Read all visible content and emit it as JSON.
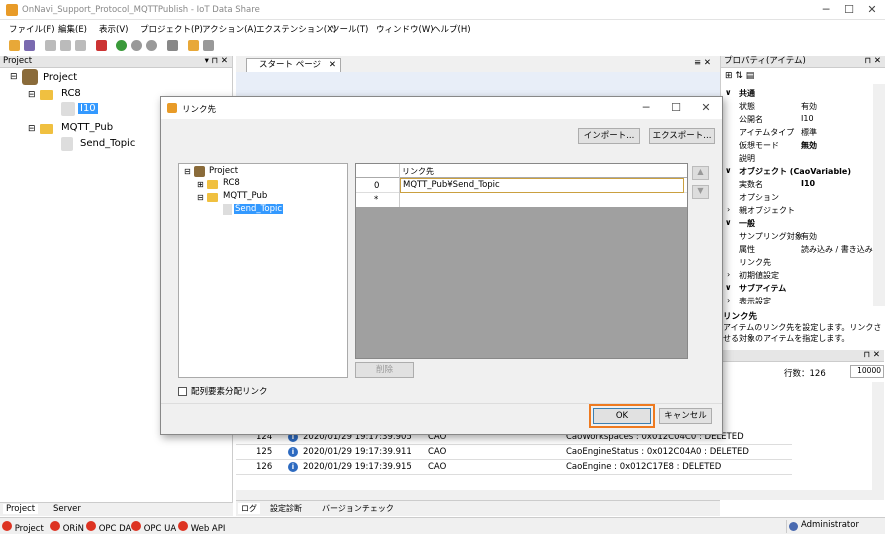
{
  "window": {
    "title": "OnNavi_Support_Protocol_MQTTPublish - IoT Data Share"
  },
  "menu": [
    "ファイル(F)",
    "編集(E)",
    "表示(V)",
    "プロジェクト(P)",
    "アクション(A)",
    "エクステンション(X)",
    "ツール(T)",
    "ウィンドウ(W)",
    "ヘルプ(H)"
  ],
  "project": {
    "header": "Project",
    "root": "Project",
    "rc8": "RC8",
    "i10": "I10",
    "mqtt": "MQTT_Pub",
    "send": "Send_Topic",
    "tab_project": "Project",
    "tab_server": "Server"
  },
  "center": {
    "tab": "スタート ページ"
  },
  "properties": {
    "header": "プロパティ(アイテム)",
    "common": "共通",
    "state_k": "状態",
    "state_v": "有効",
    "pubname_k": "公開名",
    "pubname_v": "I10",
    "itemtype_k": "アイテムタイプ",
    "itemtype_v": "標準",
    "vmode_k": "仮想モード",
    "vmode_v": "無効",
    "desc_k": "説明",
    "object": "オブジェクト (CaoVariable)",
    "objname_k": "実数名",
    "objname_v": "I10",
    "option_k": "オプション",
    "parent_k": "親オブジェクト",
    "general": "一般",
    "sampling_k": "サンプリング対象",
    "sampling_v": "有効",
    "attr_k": "属性",
    "attr_v": "読み込み / 書き込み",
    "link_k": "リンク先",
    "init_k": "初期値設定",
    "subitem": "サブアイテム",
    "display_k": "表示設定",
    "help_title": "リンク先",
    "help_text": "アイテムのリンク先を設定します。リンクさせる対象のアイテムを指定します。"
  },
  "log": {
    "rowcount_label": "行数：",
    "rowcount_value": "126",
    "limit": "10000",
    "rows": [
      {
        "no": "124",
        "time": "2020/01/29 19:17:39.905",
        "src": "CAO",
        "msg": "CaoWorkspaces : 0x012C04C0 : DELETED"
      },
      {
        "no": "125",
        "time": "2020/01/29 19:17:39.911",
        "src": "CAO",
        "msg": "CaoEngineStatus : 0x012C04A0 : DELETED"
      },
      {
        "no": "126",
        "time": "2020/01/29 19:17:39.915",
        "src": "CAO",
        "msg": "CaoEngine : 0x012C17E8 : DELETED"
      }
    ],
    "tabs": [
      "ログ",
      "設定診断",
      "バージョンチェック"
    ]
  },
  "status": {
    "items": [
      "Project",
      "ORiN",
      "OPC DA",
      "OPC UA",
      "Web API"
    ],
    "user": "Administrator"
  },
  "dialog": {
    "title": "リンク先",
    "import": "インポート...",
    "export": "エクスポート...",
    "tree": {
      "root": "Project",
      "rc8": "RC8",
      "mqtt": "MQTT_Pub",
      "send": "Send_Topic"
    },
    "grid": {
      "header": "リンク先",
      "row0_index": "0",
      "row0_value": "MQTT_Pub¥Send_Topic",
      "newrow": "*"
    },
    "delete": "削除",
    "checkbox": "配列要素分配リンク",
    "ok": "OK",
    "cancel": "キャンセル"
  }
}
